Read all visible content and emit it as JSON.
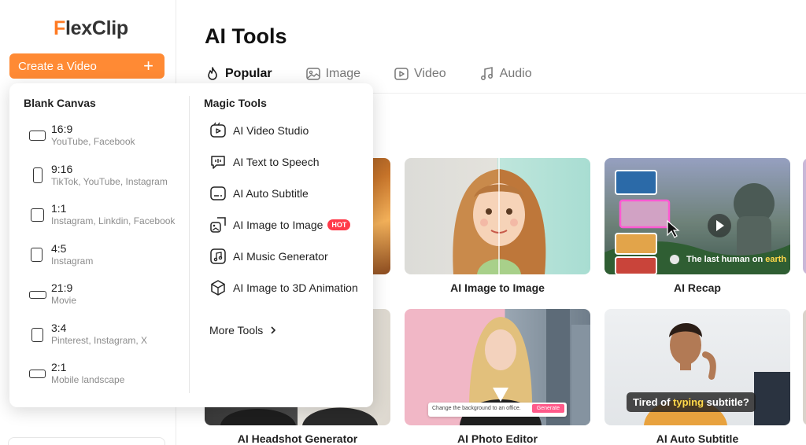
{
  "logo": {
    "f": "F",
    "rest": "lexClip"
  },
  "sidebar": {
    "create_label": "Create a Video",
    "create_icon": "+"
  },
  "main": {
    "title": "AI Tools",
    "tabs": [
      {
        "label": "Popular",
        "icon": "flame-icon"
      },
      {
        "label": "Image",
        "icon": "image-icon"
      },
      {
        "label": "Video",
        "icon": "video-icon"
      },
      {
        "label": "Audio",
        "icon": "music-note-icon"
      }
    ],
    "cards": [
      {
        "label": "AI Image to Image"
      },
      {
        "label": "AI Recap",
        "overlay": "The last human on ",
        "overlay_accent": "earth"
      },
      {
        "label": "AI Headshot Generator"
      },
      {
        "label": "AI Photo Editor",
        "prompt": "Change the background to an office.",
        "button": "Generate"
      },
      {
        "label": "AI Auto Subtitle",
        "overlay": "Tired of ",
        "overlay_accent": "typing",
        "overlay_end": " subtitle?"
      }
    ]
  },
  "dropdown": {
    "blank_heading": "Blank Canvas",
    "magic_heading": "Magic Tools",
    "ratios": [
      {
        "name": "16:9",
        "desc": "YouTube, Facebook"
      },
      {
        "name": "9:16",
        "desc": "TikTok, YouTube, Instagram"
      },
      {
        "name": "1:1",
        "desc": "Instagram, Linkdin, Facebook"
      },
      {
        "name": "4:5",
        "desc": "Instagram"
      },
      {
        "name": "21:9",
        "desc": "Movie"
      },
      {
        "name": "3:4",
        "desc": "Pinterest, Instagram, X"
      },
      {
        "name": "2:1",
        "desc": "Mobile landscape"
      }
    ],
    "tools": [
      {
        "label": "AI Video Studio",
        "icon": "video-studio-icon"
      },
      {
        "label": "AI Text to Speech",
        "icon": "speech-bubble-icon"
      },
      {
        "label": "AI Auto Subtitle",
        "icon": "subtitle-icon"
      },
      {
        "label": "AI Image to Image",
        "icon": "image-swap-icon",
        "badge": "HOT"
      },
      {
        "label": "AI Music Generator",
        "icon": "music-generator-icon"
      },
      {
        "label": "AI Image to 3D Animation",
        "icon": "cube-icon"
      }
    ],
    "more_label": "More Tools"
  },
  "colors": {
    "brand": "#ff8a34",
    "hot": "#ff3b4a",
    "accent_yellow": "#ffd84a"
  }
}
